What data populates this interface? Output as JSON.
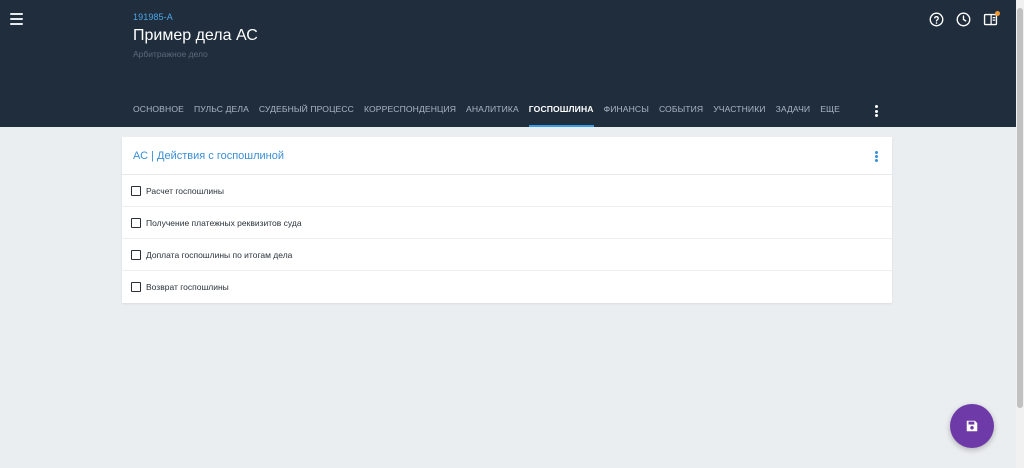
{
  "header": {
    "case_id": "191985-A",
    "title": "Пример дела АС",
    "subtitle": "Арбитражное дело",
    "icons": [
      "help-icon",
      "history-clock-icon",
      "panel-layout-icon"
    ],
    "accent": "#1f2d3d"
  },
  "tabs": [
    {
      "label": "ОСНОВНОЕ",
      "active": false
    },
    {
      "label": "ПУЛЬС ДЕЛА",
      "active": false
    },
    {
      "label": "СУДЕБНЫЙ ПРОЦЕСС",
      "active": false
    },
    {
      "label": "КОРРЕСПОНДЕНЦИЯ",
      "active": false
    },
    {
      "label": "АНАЛИТИКА",
      "active": false
    },
    {
      "label": "ГОСПОШЛИНА",
      "active": true
    },
    {
      "label": "ФИНАНСЫ",
      "active": false
    },
    {
      "label": "СОБЫТИЯ",
      "active": false
    },
    {
      "label": "УЧАСТНИКИ",
      "active": false
    },
    {
      "label": "ЗАДАЧИ",
      "active": false
    },
    {
      "label": "ЕЩЕ",
      "active": false
    }
  ],
  "card": {
    "title": "АС | Действия с госпошлиной",
    "items": [
      {
        "label": "Расчет госпошлины",
        "checked": false
      },
      {
        "label": "Получение платежных реквизитов суда",
        "checked": false
      },
      {
        "label": "Доплата госпошлины по итогам дела",
        "checked": false
      },
      {
        "label": "Возврат госпошлины",
        "checked": false
      }
    ]
  },
  "fab": {
    "icon": "save-icon",
    "color": "#6e3aa8"
  }
}
